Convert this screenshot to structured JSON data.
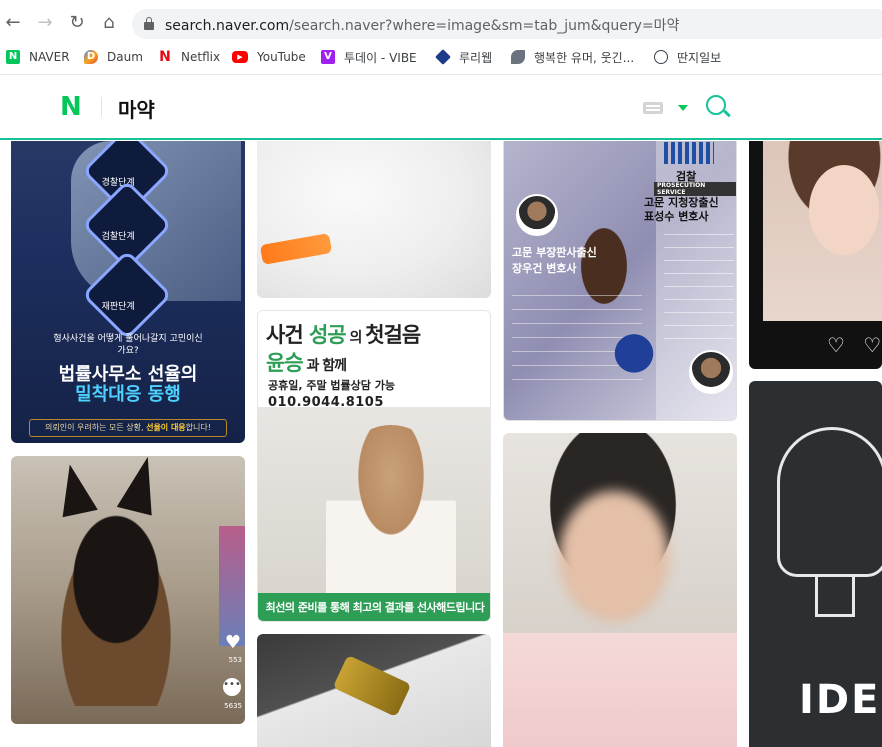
{
  "browser": {
    "url_host": "search.naver.com",
    "url_path": "/search.naver?where=image&sm=tab_jum&query=마약",
    "bookmarks": [
      {
        "label": "NAVER",
        "icon": "naver-favicon",
        "color": "#03c75a"
      },
      {
        "label": "Daum",
        "icon": "daum-favicon",
        "color": "#f7a81b"
      },
      {
        "label": "Netflix",
        "icon": "netflix-favicon",
        "color": "#e50914"
      },
      {
        "label": "YouTube",
        "icon": "youtube-favicon",
        "color": "#ff0000"
      },
      {
        "label": "투데이 - VIBE",
        "icon": "vibe-favicon",
        "color": "#a020f0"
      },
      {
        "label": "루리웹",
        "icon": "ruliweb-favicon",
        "color": "#1e3a8a"
      },
      {
        "label": "행복한 유머, 웃긴...",
        "icon": "humor-favicon",
        "color": "#6b7280"
      },
      {
        "label": "딴지일보",
        "icon": "ddanzi-favicon",
        "color": "#374151"
      }
    ]
  },
  "header": {
    "logo": "N",
    "query": "마약",
    "accent": "#15c39a"
  },
  "tiles": {
    "police": {
      "badge1": "경찰단계",
      "badge2_top": "검찰",
      "badge2": "검찰단계",
      "badge3": "재판단계",
      "tagline": "형사사건을 어떻게 풀어나갈지 고민이신가요?",
      "headline1": "법률사무소 선율의",
      "headline2": "밀착대응 동행",
      "footer_pre": "의뢰인이 우려하는 모든 상황,",
      "footer_em": "선율이 대응",
      "footer_post": "합니다!"
    },
    "law_ad": {
      "line1_a": "사건 ",
      "line1_b": "성공",
      "line1_c": " 의 ",
      "line1_d": "첫걸음",
      "line2_a": "윤승",
      "line2_b": " 과 함께",
      "line3": "공휴일, 주말 법률상담 가능",
      "phone": "010.9044.8105",
      "bottom": "최선의 준비를 통해 최고의 결과를 선사해드립니다"
    },
    "lawyers": {
      "prosecution": "검찰",
      "prosecution_en": "PROSECUTION SERVICE",
      "right_name1": "고문 지청장출신",
      "right_name2": "표성수 변호사",
      "left_name1": "고문 부장판사출신",
      "left_name2": "장우건 변호사"
    },
    "dog": {
      "likes": "553",
      "comments": "5635"
    },
    "bulb": {
      "text": "IDE"
    },
    "portrait": {
      "hearts": "♡ ♡"
    }
  }
}
